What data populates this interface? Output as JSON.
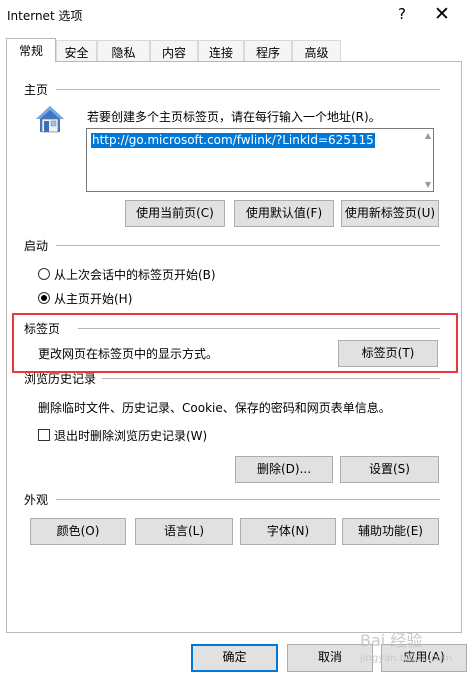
{
  "window": {
    "title": "Internet 选项",
    "help_label": "?",
    "close_label": "✕"
  },
  "tabs": [
    {
      "label": "常规",
      "active": true
    },
    {
      "label": "安全"
    },
    {
      "label": "隐私"
    },
    {
      "label": "内容"
    },
    {
      "label": "连接"
    },
    {
      "label": "程序"
    },
    {
      "label": "高级"
    }
  ],
  "home": {
    "title": "主页",
    "hint": "若要创建多个主页标签页，请在每行输入一个地址(R)。",
    "url": "http://go.microsoft.com/fwlink/?LinkId=625115",
    "buttons": {
      "use_current": "使用当前页(C)",
      "use_default": "使用默认值(F)",
      "use_new_tab": "使用新标签页(U)"
    }
  },
  "startup": {
    "title": "启动",
    "option_last_session": "从上次会话中的标签页开始(B)",
    "option_home": "从主页开始(H)",
    "selected": "home"
  },
  "tabs_section": {
    "title": "标签页",
    "desc": "更改网页在标签页中的显示方式。",
    "button": "标签页(T)"
  },
  "history": {
    "title": "浏览历史记录",
    "desc": "删除临时文件、历史记录、Cookie、保存的密码和网页表单信息。",
    "checkbox_label": "退出时删除浏览历史记录(W)",
    "checkbox_checked": false,
    "delete_button": "删除(D)...",
    "settings_button": "设置(S)"
  },
  "appearance": {
    "title": "外观",
    "colors_button": "颜色(O)",
    "languages_button": "语言(L)",
    "fonts_button": "字体(N)",
    "accessibility_button": "辅助功能(E)"
  },
  "footer": {
    "ok_button": "确定",
    "cancel_button": "取消",
    "apply_button": "应用(A)"
  },
  "watermark": {
    "line1": "Bai 经验",
    "line2": "jingyan.baidu.com"
  },
  "colors": {
    "accent": "#0078d7",
    "highlight_border": "#e8383d"
  }
}
